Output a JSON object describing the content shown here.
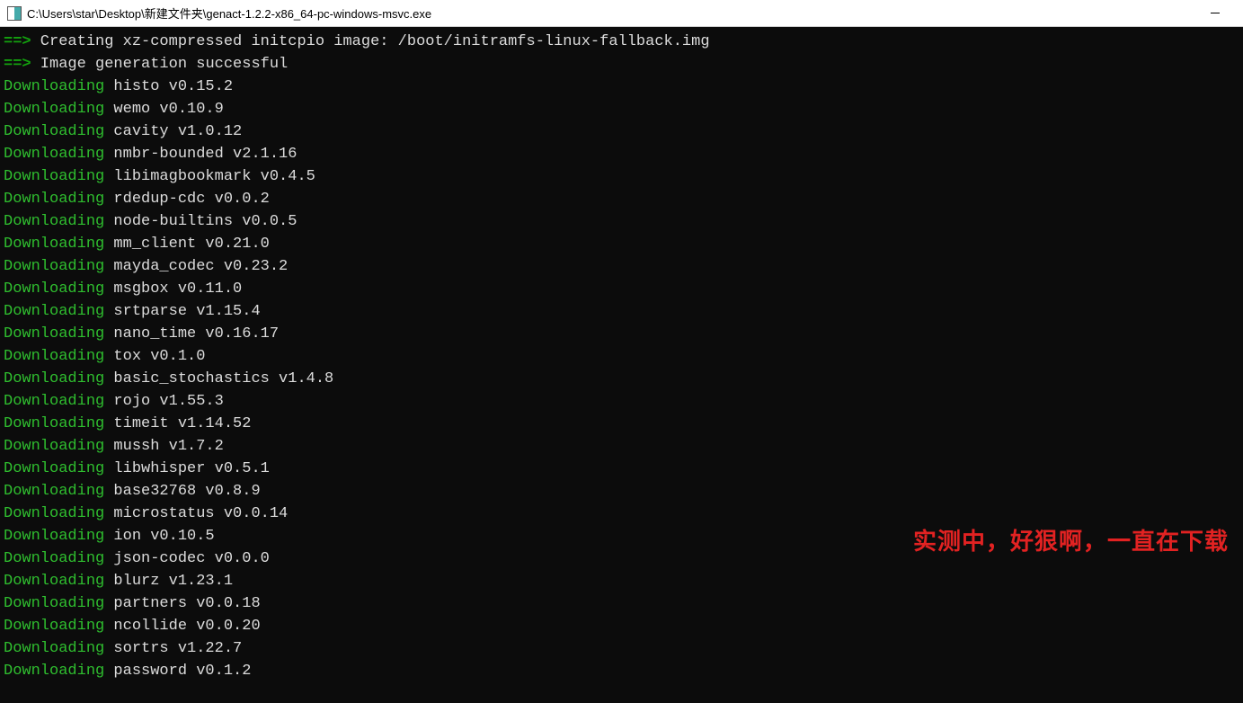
{
  "titlebar": {
    "path": "C:\\Users\\star\\Desktop\\新建文件夹\\genact-1.2.2-x86_64-pc-windows-msvc.exe"
  },
  "header_lines": [
    {
      "arrow": "==>",
      "text": " Creating xz-compressed initcpio image: /boot/initramfs-linux-fallback.img"
    },
    {
      "arrow": "==>",
      "text": " Image generation successful"
    }
  ],
  "downloads": [
    {
      "label": "Downloading",
      "pkg": " histo v0.15.2"
    },
    {
      "label": "Downloading",
      "pkg": " wemo v0.10.9"
    },
    {
      "label": "Downloading",
      "pkg": " cavity v1.0.12"
    },
    {
      "label": "Downloading",
      "pkg": " nmbr-bounded v2.1.16"
    },
    {
      "label": "Downloading",
      "pkg": " libimagbookmark v0.4.5"
    },
    {
      "label": "Downloading",
      "pkg": " rdedup-cdc v0.0.2"
    },
    {
      "label": "Downloading",
      "pkg": " node-builtins v0.0.5"
    },
    {
      "label": "Downloading",
      "pkg": " mm_client v0.21.0"
    },
    {
      "label": "Downloading",
      "pkg": " mayda_codec v0.23.2"
    },
    {
      "label": "Downloading",
      "pkg": " msgbox v0.11.0"
    },
    {
      "label": "Downloading",
      "pkg": " srtparse v1.15.4"
    },
    {
      "label": "Downloading",
      "pkg": " nano_time v0.16.17"
    },
    {
      "label": "Downloading",
      "pkg": " tox v0.1.0"
    },
    {
      "label": "Downloading",
      "pkg": " basic_stochastics v1.4.8"
    },
    {
      "label": "Downloading",
      "pkg": " rojo v1.55.3"
    },
    {
      "label": "Downloading",
      "pkg": " timeit v1.14.52"
    },
    {
      "label": "Downloading",
      "pkg": " mussh v1.7.2"
    },
    {
      "label": "Downloading",
      "pkg": " libwhisper v0.5.1"
    },
    {
      "label": "Downloading",
      "pkg": " base32768 v0.8.9"
    },
    {
      "label": "Downloading",
      "pkg": " microstatus v0.0.14"
    },
    {
      "label": "Downloading",
      "pkg": " ion v0.10.5"
    },
    {
      "label": "Downloading",
      "pkg": " json-codec v0.0.0"
    },
    {
      "label": "Downloading",
      "pkg": " blurz v1.23.1"
    },
    {
      "label": "Downloading",
      "pkg": " partners v0.0.18"
    },
    {
      "label": "Downloading",
      "pkg": " ncollide v0.0.20"
    },
    {
      "label": "Downloading",
      "pkg": " sortrs v1.22.7"
    },
    {
      "label": "Downloading",
      "pkg": " password v0.1.2"
    }
  ],
  "annotation": "实测中，好狠啊，一直在下载"
}
